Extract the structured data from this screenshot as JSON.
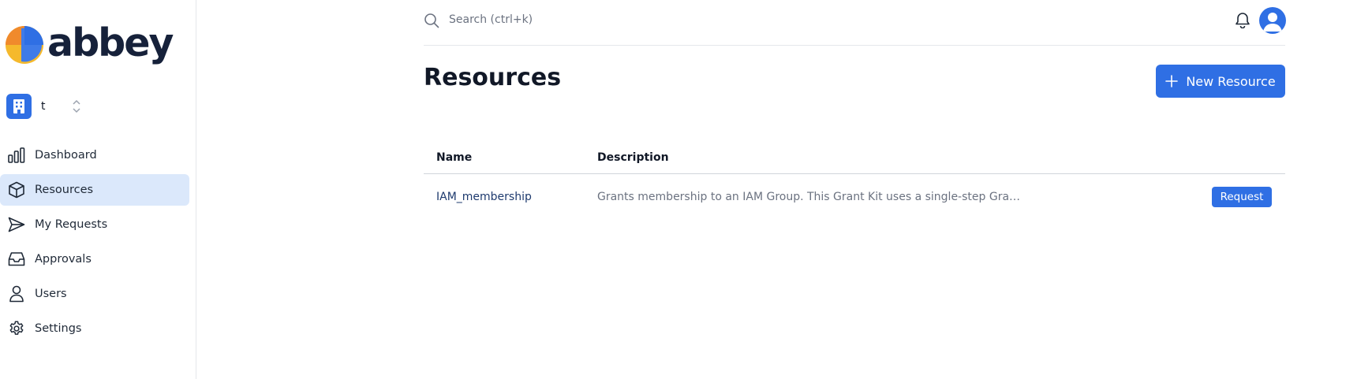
{
  "brand": {
    "name": "abbey"
  },
  "org": {
    "name": "t"
  },
  "sidebar": {
    "items": [
      {
        "label": "Dashboard",
        "icon": "chart-bar-icon",
        "active": false
      },
      {
        "label": "Resources",
        "icon": "cube-icon",
        "active": true
      },
      {
        "label": "My Requests",
        "icon": "paper-plane-icon",
        "active": false
      },
      {
        "label": "Approvals",
        "icon": "inbox-icon",
        "active": false
      },
      {
        "label": "Users",
        "icon": "user-icon",
        "active": false
      },
      {
        "label": "Settings",
        "icon": "gear-icon",
        "active": false
      }
    ]
  },
  "search": {
    "placeholder": "Search (ctrl+k)",
    "value": ""
  },
  "header": {
    "title": "Resources",
    "new_button_label": "New Resource"
  },
  "table": {
    "columns": [
      "Name",
      "Description"
    ],
    "rows": [
      {
        "name": "IAM_membership",
        "description": "Grants membership to an IAM Group. This Grant Kit uses a single-step Gra…",
        "action_label": "Request"
      }
    ]
  },
  "colors": {
    "accent": "#2f6fe4",
    "active_nav_bg": "#dbe8fb",
    "brand_text": "#16213a"
  }
}
